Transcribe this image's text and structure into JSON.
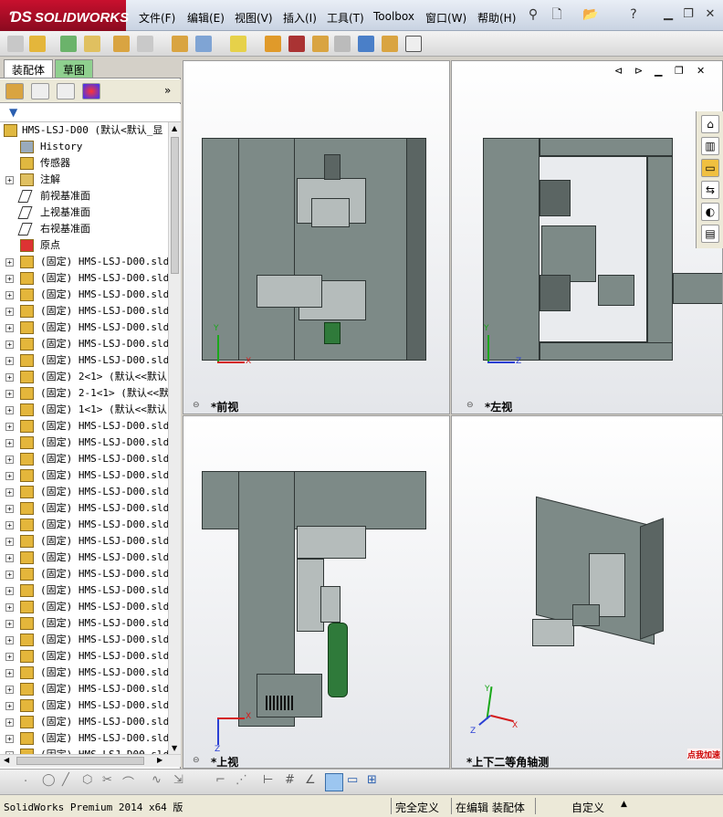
{
  "app": {
    "logo": "SOLIDWORKS",
    "menu": [
      "文件(F)",
      "编辑(E)",
      "视图(V)",
      "插入(I)",
      "工具(T)",
      "Toolbox",
      "窗口(W)",
      "帮助(H)"
    ]
  },
  "panel": {
    "tabs": [
      "装配体",
      "草图"
    ],
    "tree": [
      {
        "label": "HMS-LSJ-D00  (默认<默认_显",
        "icon": "assembly-icon",
        "expand": ""
      },
      {
        "label": "History",
        "icon": "history-icon",
        "expand": ""
      },
      {
        "label": "传感器",
        "icon": "sensor-icon",
        "expand": ""
      },
      {
        "label": "注解",
        "icon": "annotation-icon",
        "expand": "+"
      },
      {
        "label": "前视基准面",
        "icon": "plane-icon",
        "expand": ""
      },
      {
        "label": "上视基准面",
        "icon": "plane-icon",
        "expand": ""
      },
      {
        "label": "右视基准面",
        "icon": "plane-icon",
        "expand": ""
      },
      {
        "label": "原点",
        "icon": "origin-icon",
        "expand": ""
      },
      {
        "label": "(固定) HMS-LSJ-D00.slda",
        "icon": "part-icon",
        "expand": "+"
      },
      {
        "label": "(固定) HMS-LSJ-D00.slda",
        "icon": "part-icon",
        "expand": "+"
      },
      {
        "label": "(固定) HMS-LSJ-D00.slda",
        "icon": "part-icon",
        "expand": "+"
      },
      {
        "label": "(固定) HMS-LSJ-D00.slda",
        "icon": "part-icon",
        "expand": "+"
      },
      {
        "label": "(固定) HMS-LSJ-D00.slda",
        "icon": "part-icon",
        "expand": "+"
      },
      {
        "label": "(固定) HMS-LSJ-D00.slda",
        "icon": "part-icon",
        "expand": "+"
      },
      {
        "label": "(固定) HMS-LSJ-D00.slda",
        "icon": "part-icon",
        "expand": "+"
      },
      {
        "label": "(固定) 2<1> (默认<<默认",
        "icon": "part-icon",
        "expand": "+"
      },
      {
        "label": "(固定) 2-1<1> (默认<<默",
        "icon": "part-icon",
        "expand": "+"
      },
      {
        "label": "(固定) 1<1> (默认<<默认",
        "icon": "part-icon",
        "expand": "+"
      },
      {
        "label": "(固定) HMS-LSJ-D00.slda",
        "icon": "part-icon",
        "expand": "+"
      },
      {
        "label": "(固定) HMS-LSJ-D00.slda",
        "icon": "part-icon",
        "expand": "+"
      },
      {
        "label": "(固定) HMS-LSJ-D00.slda",
        "icon": "part-icon",
        "expand": "+"
      },
      {
        "label": "(固定) HMS-LSJ-D00.slda",
        "icon": "part-icon",
        "expand": "+"
      },
      {
        "label": "(固定) HMS-LSJ-D00.slda",
        "icon": "part-icon",
        "expand": "+"
      },
      {
        "label": "(固定) HMS-LSJ-D00.slda",
        "icon": "part-icon",
        "expand": "+"
      },
      {
        "label": "(固定) HMS-LSJ-D00.slda",
        "icon": "part-icon",
        "expand": "+"
      },
      {
        "label": "(固定) HMS-LSJ-D00.slda",
        "icon": "part-icon",
        "expand": "+"
      },
      {
        "label": "(固定) HMS-LSJ-D00.slda",
        "icon": "part-icon",
        "expand": "+"
      },
      {
        "label": "(固定) HMS-LSJ-D00.slda",
        "icon": "part-icon",
        "expand": "+"
      },
      {
        "label": "(固定) HMS-LSJ-D00.slda",
        "icon": "part-icon",
        "expand": "+"
      },
      {
        "label": "(固定) HMS-LSJ-D00.slda",
        "icon": "part-icon",
        "expand": "+"
      },
      {
        "label": "(固定) HMS-LSJ-D00.slda",
        "icon": "part-icon",
        "expand": "+"
      },
      {
        "label": "(固定) HMS-LSJ-D00.slda",
        "icon": "part-icon",
        "expand": "+"
      },
      {
        "label": "(固定) HMS-LSJ-D00.slda",
        "icon": "part-icon",
        "expand": "+"
      },
      {
        "label": "(固定) HMS-LSJ-D00.slda",
        "icon": "part-icon",
        "expand": "+"
      },
      {
        "label": "(固定) HMS-LSJ-D00.slda",
        "icon": "part-icon",
        "expand": "+"
      },
      {
        "label": "(固定) HMS-LSJ-D00.slda",
        "icon": "part-icon",
        "expand": "+"
      },
      {
        "label": "(固定) HMS-LSJ-D00.slda",
        "icon": "part-icon",
        "expand": "+"
      },
      {
        "label": "(固定) HMS-LSJ-D00.slda",
        "icon": "part-icon",
        "expand": "+"
      },
      {
        "label": "(固定) HMS-LSJ-D00.slda",
        "icon": "part-icon",
        "expand": "+"
      }
    ]
  },
  "viewports": {
    "front": "*前视",
    "left": "*左视",
    "top": "*上视",
    "iso": "*上下二等角轴测"
  },
  "axes": {
    "x": "X",
    "y": "Y",
    "z": "Z"
  },
  "status": {
    "app": "SolidWorks Premium 2014 x64 版",
    "definition": "完全定义",
    "editing": "在编辑 装配体",
    "custom": "自定义"
  },
  "badge": "点我加速",
  "colors": {
    "model": "#7d8a87",
    "brand": "#c8102e",
    "accent_green": "#2f7a3a"
  }
}
